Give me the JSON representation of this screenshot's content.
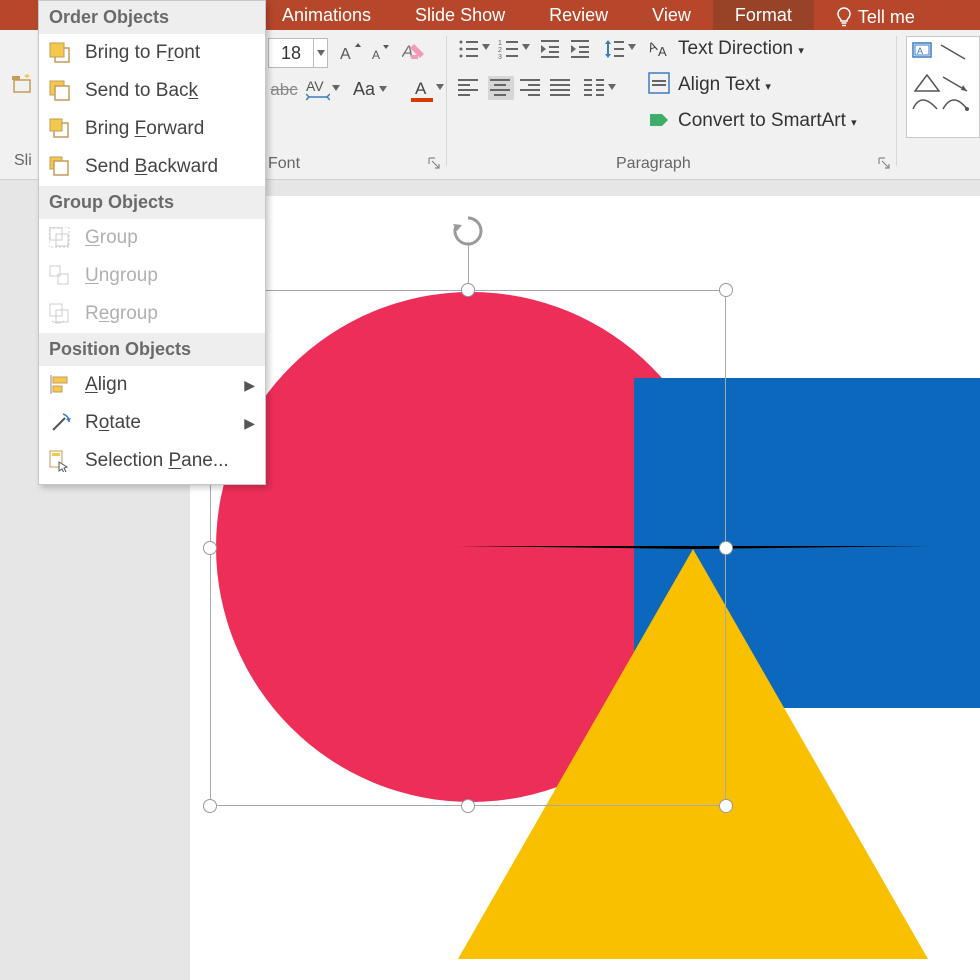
{
  "tabs": {
    "animations": "Animations",
    "slideshow": "Slide Show",
    "review": "Review",
    "view": "View",
    "format": "Format",
    "tellme": "Tell me"
  },
  "ribbon": {
    "fontsize": "18",
    "font_group_label": "Font",
    "paragraph_group_label": "Paragraph",
    "slides_label": "Sli",
    "text_direction": "Text Direction",
    "align_text": "Align Text",
    "convert_smartart": "Convert to SmartArt"
  },
  "menu": {
    "order_header": "Order Objects",
    "bring_front_pre": "Bring to F",
    "bring_front_u": "r",
    "bring_front_post": "ont",
    "send_back_pre": "Send to Bac",
    "send_back_u": "k",
    "send_back_post": "",
    "bring_forward_pre": "Bring ",
    "bring_forward_u": "F",
    "bring_forward_post": "orward",
    "send_backward_pre": "Send ",
    "send_backward_u": "B",
    "send_backward_post": "ackward",
    "group_header": "Group Objects",
    "group_pre": "",
    "group_u": "G",
    "group_post": "roup",
    "ungroup_pre": "",
    "ungroup_u": "U",
    "ungroup_post": "ngroup",
    "regroup_pre": "R",
    "regroup_u": "e",
    "regroup_post": "group",
    "position_header": "Position Objects",
    "align_pre": "",
    "align_u": "A",
    "align_post": "lign",
    "rotate_pre": "R",
    "rotate_u": "o",
    "rotate_post": "tate",
    "selpane_pre": "Selection ",
    "selpane_u": "P",
    "selpane_post": "ane..."
  },
  "colors": {
    "circle": "#ed2e58",
    "rect": "#0b68bd",
    "triangle": "#f9c000",
    "tab_bg": "#b7472a"
  }
}
